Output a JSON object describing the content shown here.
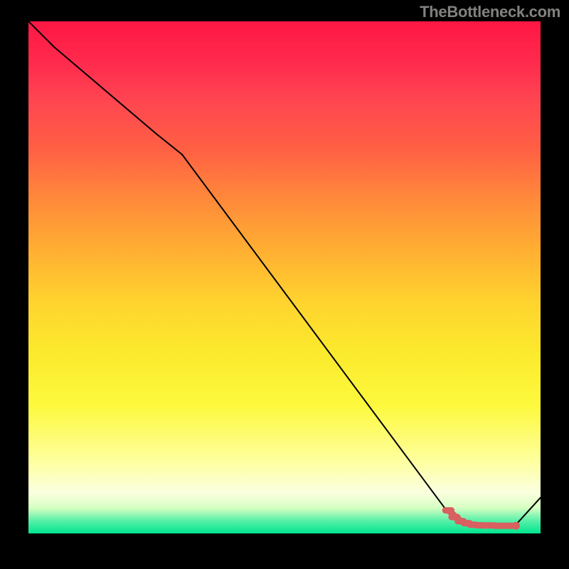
{
  "watermark": "TheBottleneck.com",
  "chart_data": {
    "type": "line",
    "title": "",
    "xlabel": "",
    "ylabel": "",
    "xlim": [
      0,
      100
    ],
    "ylim": [
      0,
      100
    ],
    "series": [
      {
        "name": "bottleneck-curve",
        "x": [
          0,
          5,
          25,
          30,
          82,
          85,
          88,
          90,
          92,
          95,
          100
        ],
        "y": [
          100,
          95,
          78,
          74,
          4,
          2,
          1.5,
          1.5,
          1.5,
          1.5,
          7
        ]
      }
    ],
    "markers": {
      "name": "bottleneck-zone",
      "color": "#d86060",
      "points": [
        {
          "x": 82.0,
          "y": 4.5
        },
        {
          "x": 83.2,
          "y": 3.2
        },
        {
          "x": 84.4,
          "y": 2.4
        },
        {
          "x": 85.6,
          "y": 2.0
        },
        {
          "x": 86.8,
          "y": 1.7
        },
        {
          "x": 88.0,
          "y": 1.6
        },
        {
          "x": 89.2,
          "y": 1.55
        },
        {
          "x": 90.4,
          "y": 1.55
        },
        {
          "x": 91.6,
          "y": 1.5
        },
        {
          "x": 92.8,
          "y": 1.5
        },
        {
          "x": 94.0,
          "y": 1.5
        },
        {
          "x": 95.2,
          "y": 1.5
        }
      ]
    },
    "gradient_stops": [
      {
        "pos": 0.0,
        "color": "#ff1744"
      },
      {
        "pos": 0.5,
        "color": "#ffd42e"
      },
      {
        "pos": 0.92,
        "color": "#fbffdf"
      },
      {
        "pos": 1.0,
        "color": "#00e58f"
      }
    ]
  }
}
